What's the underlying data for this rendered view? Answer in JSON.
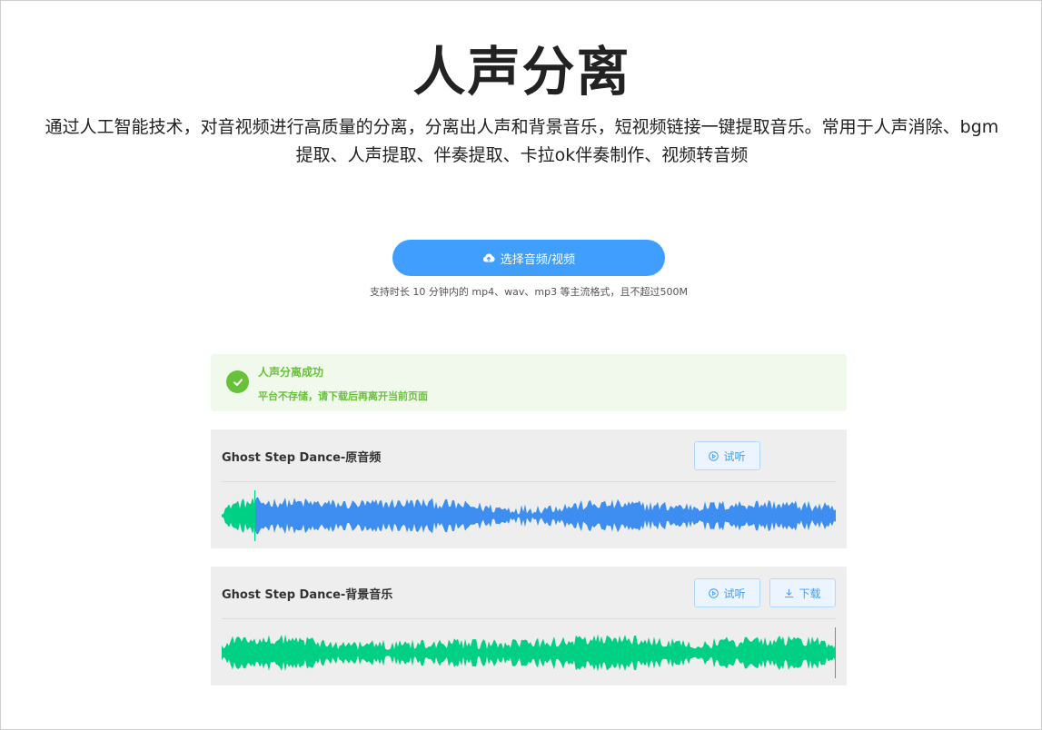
{
  "page": {
    "title": "人声分离",
    "description": "通过人工智能技术，对音视频进行高质量的分离，分离出人声和背景音乐，短视频链接一键提取音乐。常用于人声消除、bgm提取、人声提取、伴奏提取、卡拉ok伴奏制作、视频转音频"
  },
  "upload": {
    "button_label": "选择音频/视频",
    "icon": "cloud-upload-icon",
    "hint": "支持时长 10 分钟内的 mp4、wav、mp3 等主流格式，且不超过500M"
  },
  "alert": {
    "title": "人声分离成功",
    "description": "平台不存储，请下载后再离开当前页面",
    "icon": "check-circle-icon",
    "color": "#67c23a",
    "background": "#f0f9eb"
  },
  "tracks": [
    {
      "name": "Ghost Step Dance-原音频",
      "listen_label": "试听",
      "download_label": "",
      "playback_progress": 0.053,
      "wave_color": "#3d8ef0",
      "progress_color": "#00d084"
    },
    {
      "name": "Ghost Step Dance-背景音乐",
      "listen_label": "试听",
      "download_label": "下载",
      "playback_progress": 1.0,
      "wave_color": "#00d084",
      "progress_color": "#00d084"
    }
  ],
  "colors": {
    "primary": "#409eff",
    "panel": "#eeeeee"
  }
}
